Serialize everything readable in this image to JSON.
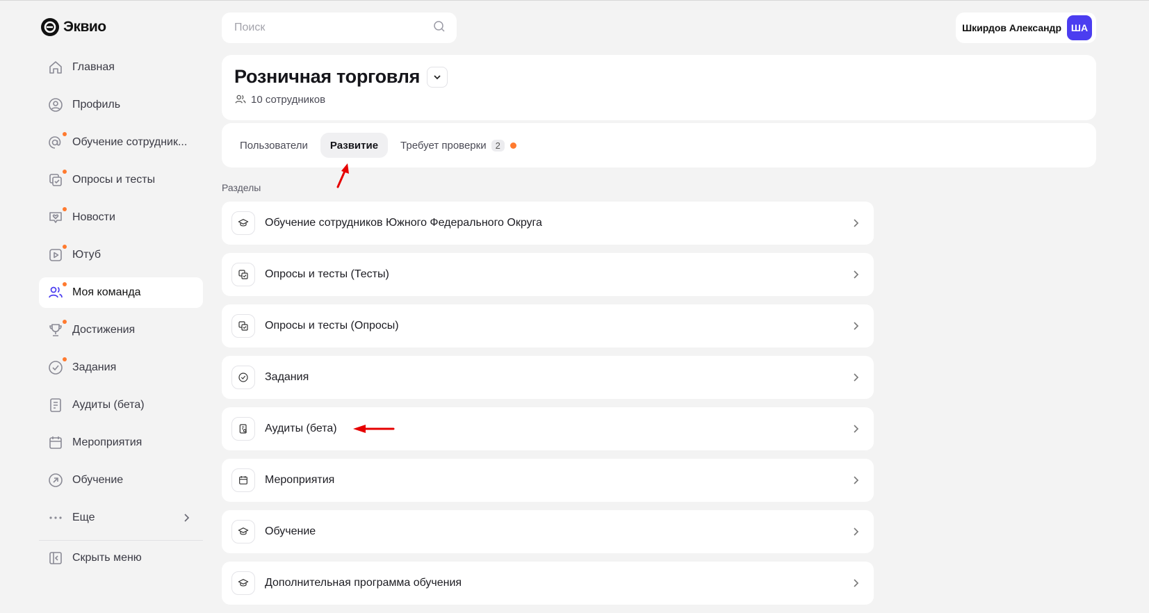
{
  "app": {
    "logo_text": "Эквио"
  },
  "sidebar": {
    "items": [
      {
        "label": "Главная",
        "icon": "home-icon",
        "dot": false,
        "active": false
      },
      {
        "label": "Профиль",
        "icon": "profile-icon",
        "dot": false,
        "active": false
      },
      {
        "label": "Обучение сотрудник...",
        "icon": "at-icon",
        "dot": true,
        "active": false
      },
      {
        "label": "Опросы и тесты",
        "icon": "survey-icon",
        "dot": true,
        "active": false
      },
      {
        "label": "Новости",
        "icon": "news-icon",
        "dot": true,
        "active": false
      },
      {
        "label": "Ютуб",
        "icon": "video-icon",
        "dot": true,
        "active": false
      },
      {
        "label": "Моя команда",
        "icon": "team-icon",
        "dot": true,
        "active": true
      },
      {
        "label": "Достижения",
        "icon": "trophy-icon",
        "dot": true,
        "active": false
      },
      {
        "label": "Задания",
        "icon": "check-circle-icon",
        "dot": true,
        "active": false
      },
      {
        "label": "Аудиты (бета)",
        "icon": "audit-icon",
        "dot": false,
        "active": false
      },
      {
        "label": "Мероприятия",
        "icon": "calendar-icon",
        "dot": false,
        "active": false
      },
      {
        "label": "Обучение",
        "icon": "learning-icon",
        "dot": false,
        "active": false
      }
    ],
    "more_label": "Еще",
    "hide_label": "Скрыть меню"
  },
  "search": {
    "placeholder": "Поиск",
    "value": ""
  },
  "user": {
    "name": "Шкирдов Александр",
    "initials": "ША"
  },
  "team": {
    "title": "Розничная торговля",
    "employees": "10 сотрудников"
  },
  "tabs": [
    {
      "label": "Пользователи",
      "active": false
    },
    {
      "label": "Развитие",
      "active": true
    },
    {
      "label": "Требует проверки",
      "active": false,
      "count": "2",
      "dot": true
    }
  ],
  "sections_label": "Разделы",
  "sections": [
    {
      "label": "Обучение сотрудников Южного Федерального Округа",
      "icon": "graduation-cap-icon"
    },
    {
      "label": "Опросы и тесты (Тесты)",
      "icon": "survey-icon"
    },
    {
      "label": "Опросы и тесты (Опросы)",
      "icon": "survey-icon"
    },
    {
      "label": "Задания",
      "icon": "check-circle-icon"
    },
    {
      "label": "Аудиты (бета)",
      "icon": "audit-icon"
    },
    {
      "label": "Мероприятия",
      "icon": "calendar-icon"
    },
    {
      "label": "Обучение",
      "icon": "graduation-cap-icon"
    },
    {
      "label": "Дополнительная программа обучения",
      "icon": "graduation-cap-icon"
    }
  ],
  "colors": {
    "accent": "#4b3df0",
    "dot": "#ff7a2f",
    "background": "#f3f3f3",
    "annotation": "#e60000"
  }
}
